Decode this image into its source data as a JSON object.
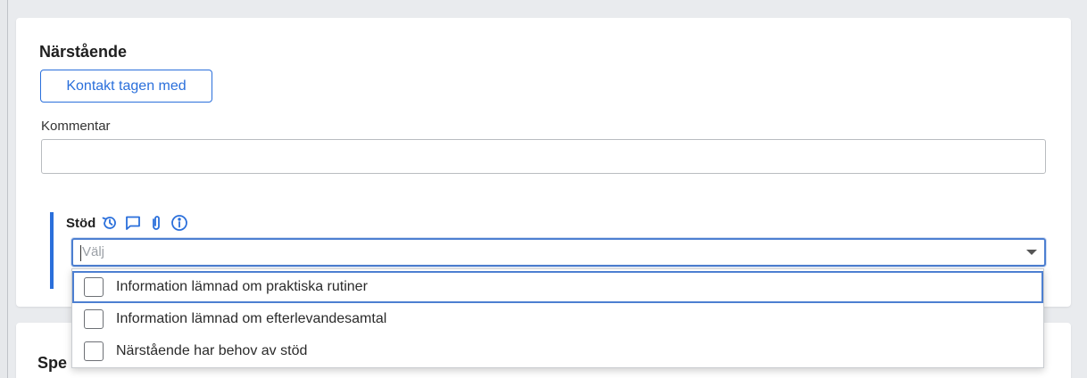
{
  "section": {
    "title": "Närstående",
    "contact_button_label": "Kontakt tagen med",
    "comment_label": "Kommentar",
    "comment_value": ""
  },
  "stod": {
    "label": "Stöd",
    "icons": [
      "history-icon",
      "comment-icon",
      "paperclip-icon",
      "info-icon"
    ],
    "select_placeholder": "Välj",
    "options": [
      "Information lämnad om praktiska rutiner",
      "Information lämnad om efterlevandesamtal",
      "Närstående har behov av stöd"
    ]
  },
  "next_section": {
    "title_partial": "Spe"
  },
  "colors": {
    "accent": "#2a6fdb",
    "focus": "#4d7fd1",
    "background": "#e9ebee"
  }
}
